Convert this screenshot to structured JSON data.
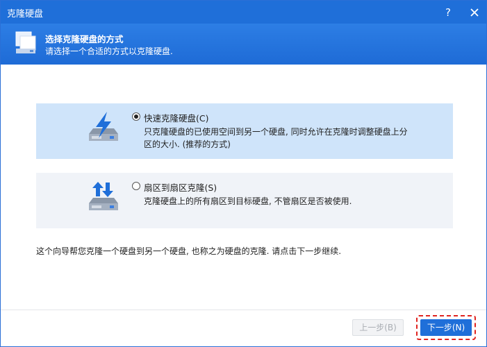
{
  "window": {
    "title": "克隆硬盘"
  },
  "header": {
    "title": "选择克隆硬盘的方式",
    "subtitle": "请选择一个合适的方式以克隆硬盘."
  },
  "options": [
    {
      "label": "快速克隆硬盘(C)",
      "description": "只克隆硬盘的已使用空间到另一个硬盘, 同时允许在克隆时调整硬盘上分区的大小. (推荐的方式)",
      "selected": true,
      "icon": "disk-lightning-icon"
    },
    {
      "label": "扇区到扇区克隆(S)",
      "description": "克隆硬盘上的所有扇区到目标硬盘, 不管扇区是否被使用.",
      "selected": false,
      "icon": "disk-arrows-icon"
    }
  ],
  "info_text": "这个向导帮您克隆一个硬盘到另一个硬盘, 也称之为硬盘的克隆. 请点击下一步继续.",
  "buttons": {
    "prev": "上一步(B)",
    "next": "下一步(N)"
  },
  "colors": {
    "titlebar": "#1f6fd9",
    "selected_bg": "#cfe4fa",
    "accent": "#1f6fd9",
    "focus": "#e0231f"
  }
}
